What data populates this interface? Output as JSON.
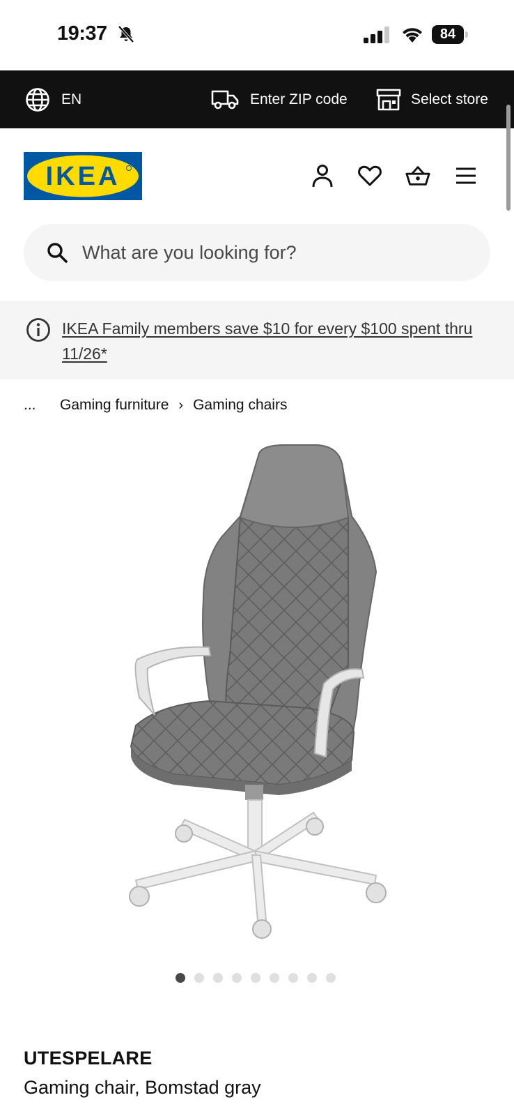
{
  "status_bar": {
    "time": "19:37",
    "battery": "84"
  },
  "topbar": {
    "language": "EN",
    "zip_label": "Enter ZIP code",
    "store_label": "Select store"
  },
  "header": {
    "logo_text": "IKEA",
    "brand_colors": {
      "blue": "#0058a3",
      "yellow": "#ffdb00"
    },
    "icons": [
      "account-icon",
      "heart-icon",
      "basket-icon",
      "menu-icon"
    ]
  },
  "search": {
    "placeholder": "What are you looking for?"
  },
  "promo": {
    "text": "IKEA Family members save $10 for every $100 spent thru 11/26*"
  },
  "breadcrumb": {
    "ellipsis": "...",
    "items": [
      "Gaming furniture",
      "Gaming chairs"
    ],
    "separator": "›"
  },
  "carousel": {
    "total": 9,
    "active_index": 0
  },
  "product": {
    "name": "UTESPELARE",
    "description": "Gaming chair, Bomstad gray"
  }
}
